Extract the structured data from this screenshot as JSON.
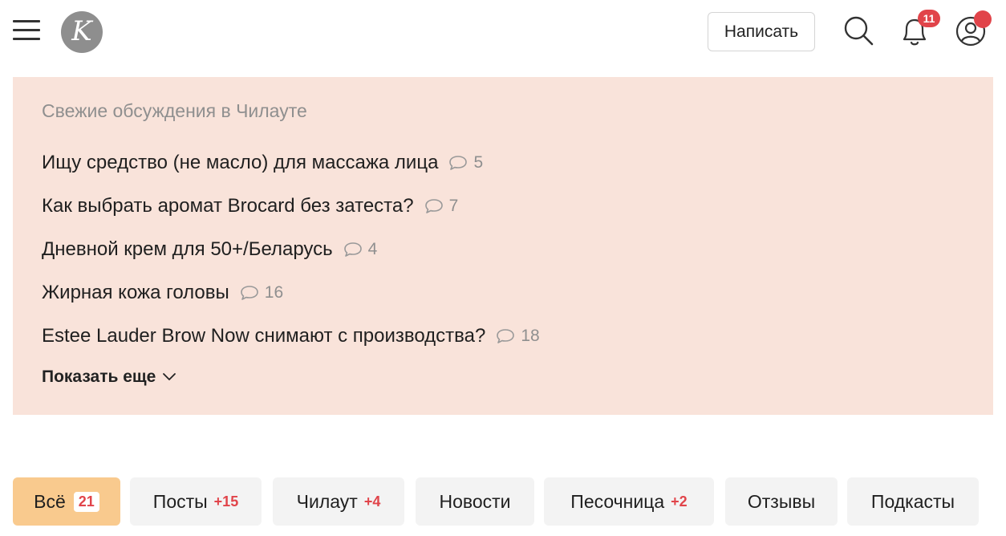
{
  "header": {
    "logo_letter": "K",
    "write_label": "Написать",
    "notifications_count": "11",
    "icons": [
      "menu-icon",
      "search-icon",
      "bell-icon",
      "user-icon"
    ],
    "accent_color": "#e1444a"
  },
  "discussions": {
    "title": "Свежие обсуждения в Чилауте",
    "items": [
      {
        "title": "Ищу средство (не масло) для массажа лица",
        "comments": "5"
      },
      {
        "title": "Как выбрать аромат Brocard без затеста?",
        "comments": "7"
      },
      {
        "title": "Дневной крем для 50+/Беларусь",
        "comments": "4"
      },
      {
        "title": "Жирная кожа головы",
        "comments": "16"
      },
      {
        "title": "Estee Lauder Brow Now снимают с производства?",
        "comments": "18"
      }
    ],
    "show_more": "Показать еще",
    "background_color": "#f9e3da"
  },
  "tabs": [
    {
      "label": "Всё",
      "count": "21"
    },
    {
      "label": "Посты",
      "count": "+15"
    },
    {
      "label": "Чилаут",
      "count": "+4"
    },
    {
      "label": "Новости",
      "count": ""
    },
    {
      "label": "Песочница",
      "count": "+2"
    },
    {
      "label": "Отзывы",
      "count": ""
    },
    {
      "label": "Подкасты",
      "count": ""
    }
  ]
}
